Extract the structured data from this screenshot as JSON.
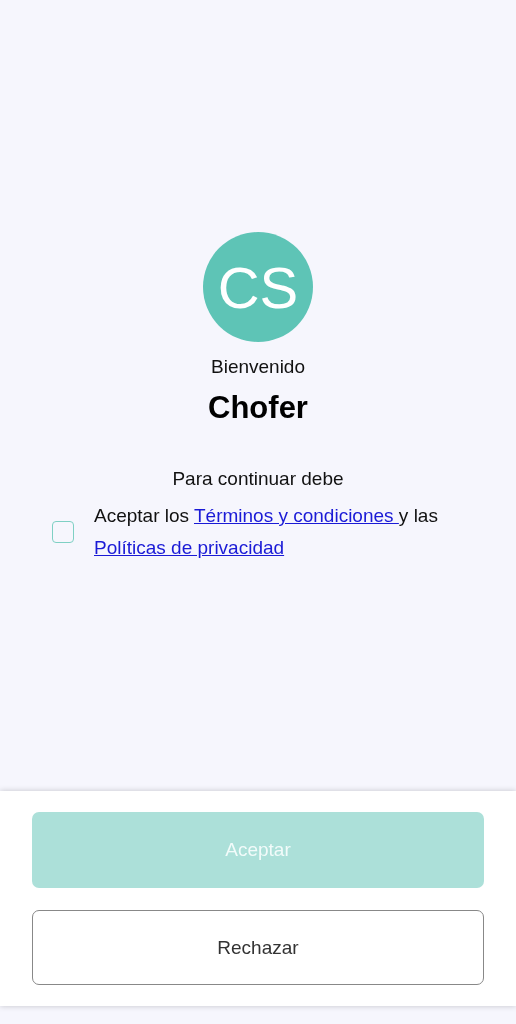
{
  "avatar": {
    "initials": "CS"
  },
  "greeting": "Bienvenido",
  "name": "Chofer",
  "instruction": "Para continuar debe",
  "consent": {
    "checked": false,
    "prefix": "Aceptar los ",
    "terms_link": "Términos y condiciones ",
    "middle": "y las ",
    "privacy_link": "Políticas de privacidad"
  },
  "buttons": [
    {
      "label": "Aceptar",
      "kind": "primary",
      "disabled": true
    },
    {
      "label": "Rechazar",
      "kind": "outline",
      "disabled": false
    }
  ]
}
